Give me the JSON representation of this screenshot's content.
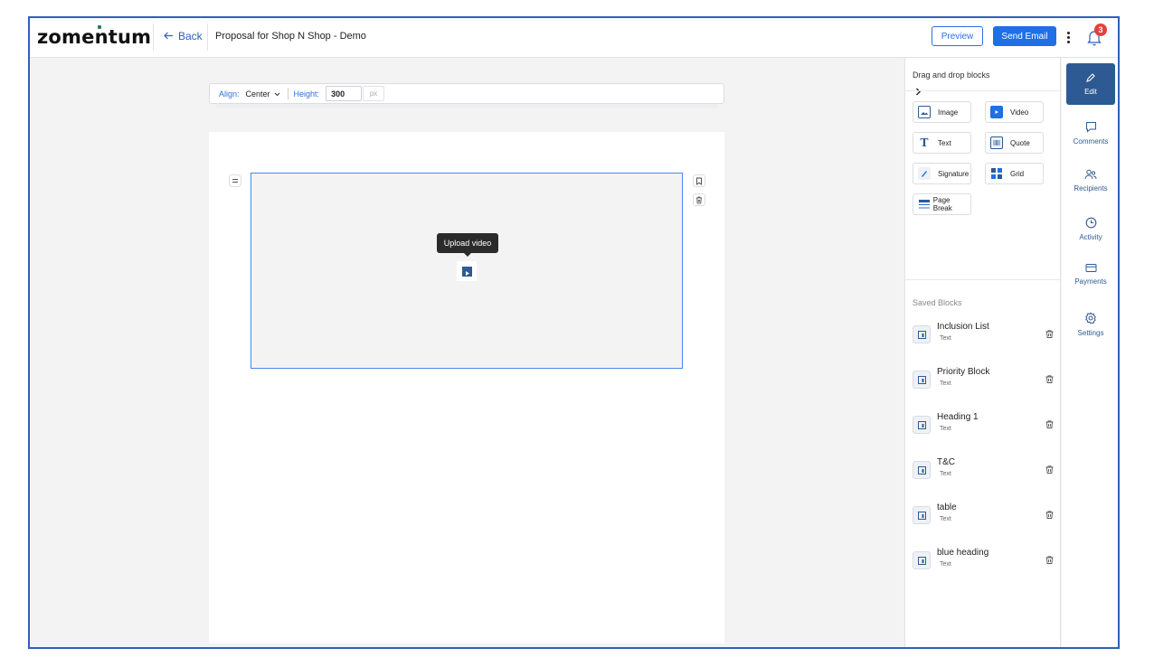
{
  "header": {
    "logo": "zomentum",
    "back_label": "Back",
    "doc_title": "Proposal for Shop N Shop - Demo",
    "preview_label": "Preview",
    "send_email_label": "Send Email",
    "notification_count": "3"
  },
  "toolbar": {
    "align_label": "Align:",
    "align_value": "Center",
    "height_label": "Height:",
    "height_value": "300",
    "height_unit": "px"
  },
  "canvas": {
    "tooltip": "Upload video"
  },
  "panel": {
    "title": "Drag and drop blocks",
    "blocks": [
      "Image",
      "Video",
      "Text",
      "Quote",
      "Signature",
      "Grid",
      "Page Break"
    ],
    "saved_title": "Saved Blocks",
    "saved": [
      {
        "name": "Inclusion List",
        "type": "Text"
      },
      {
        "name": "Priority Block",
        "type": "Text"
      },
      {
        "name": "Heading 1",
        "type": "Text"
      },
      {
        "name": "T&C",
        "type": "Text"
      },
      {
        "name": "table",
        "type": "Text"
      },
      {
        "name": "blue heading",
        "type": "Text"
      }
    ]
  },
  "rail": {
    "items": [
      "Edit",
      "Comments",
      "Recipients",
      "Activity",
      "Payments",
      "Settings"
    ]
  },
  "colors": {
    "accent": "#1f6fe6",
    "rail_active": "#2e5a93",
    "frame_border": "#2f5fbd",
    "badge": "#e2423b"
  },
  "icons": {
    "back": "arrow-left-icon",
    "kebab": "more-vertical-icon",
    "bell": "bell-icon",
    "collapse": "chevron-right-icon",
    "upload": "video-play-icon",
    "bookmark": "bookmark-icon",
    "trash": "trash-icon"
  }
}
